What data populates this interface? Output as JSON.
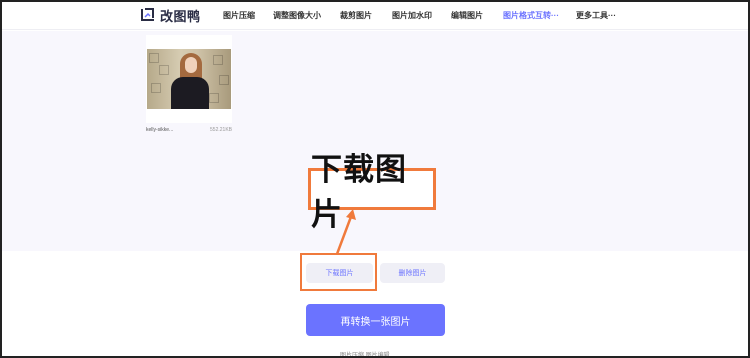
{
  "brand": {
    "logo_text": "改图鸭",
    "accent": "#6b73ff",
    "annotation_color": "#f07a3c"
  },
  "nav": {
    "items": [
      {
        "label": "图片压缩",
        "active": false
      },
      {
        "label": "调整图像大小",
        "active": false
      },
      {
        "label": "裁剪图片",
        "active": false
      },
      {
        "label": "图片加水印",
        "active": false
      },
      {
        "label": "编辑图片",
        "active": false
      },
      {
        "label": "图片格式互转···",
        "active": true
      },
      {
        "label": "更多工具···",
        "active": false
      }
    ]
  },
  "file": {
    "name": "kelly-sikke...",
    "size": "552.21KB"
  },
  "annotation": {
    "label": "下载图片"
  },
  "actions": {
    "download_label": "下载图片",
    "delete_label": "删除图片",
    "convert_again_label": "再转换一张图片"
  },
  "footer": {
    "text": "图片压缩  图片编辑"
  }
}
